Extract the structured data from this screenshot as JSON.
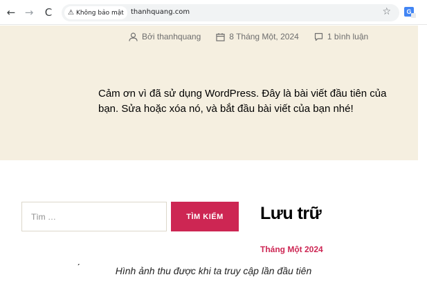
{
  "browser": {
    "back_icon": "←",
    "forward_icon": "→",
    "reload_icon": "C",
    "security_warning_icon": "⚠",
    "security_label": "Không bảo mật",
    "url": "thanhquang.com",
    "bookmark_icon": "☆",
    "translate_icon": "G"
  },
  "post": {
    "author": "Bởi thanhquang",
    "date": "8 Tháng Một, 2024",
    "comments": "1 bình luận",
    "body": "Cảm ơn vì đã sử dụng WordPress. Đây là bài viết đầu tiên của bạn. Sửa hoặc xóa nó, và bắt đầu bài viết của bạn nhé!"
  },
  "search": {
    "placeholder": "Tìm …",
    "button_label": "TÌM KIẾM"
  },
  "archive": {
    "title": "Lưu trữ",
    "link": "Tháng Một 2024"
  },
  "stray_mark": "ˏ",
  "caption": "Hình ảnh thu được khi ta truy cập lần đầu tiên",
  "colors": {
    "post_background": "#f5efe0",
    "accent": "#cd2653"
  }
}
